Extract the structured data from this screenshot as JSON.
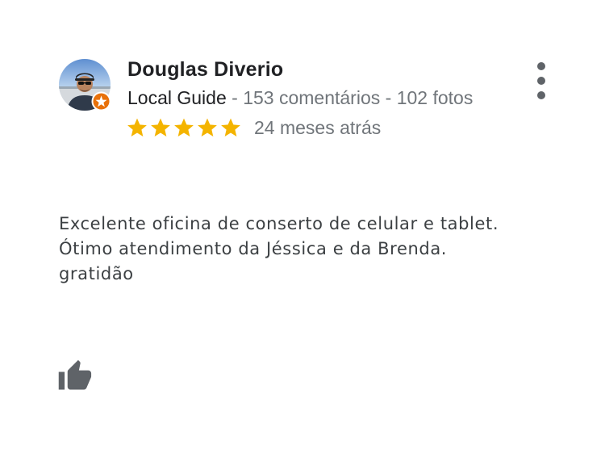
{
  "reviewer": {
    "name": "Douglas Diverio",
    "guide_label": "Local Guide",
    "separator_1": " - ",
    "reviews_count": "153 comentários",
    "separator_2": " - ",
    "photos_count": "102 fotos",
    "avatar_icon": "profile-photo",
    "badge_icon": "local-guide-star-badge"
  },
  "rating": {
    "stars": 5,
    "max": 5,
    "star_color": "#f4b400",
    "date": "24 meses atrás"
  },
  "review": {
    "lines": [
      "Excelente oficina de conserto de celular e tablet.",
      "Ótimo atendimento da Jéssica e da Brenda.",
      "gratidão"
    ]
  },
  "actions": {
    "more_icon": "more-vertical-icon",
    "like_icon": "thumbs-up-icon"
  },
  "colors": {
    "name": "#202124",
    "meta": "#70757a",
    "body_text": "#3c4043",
    "icon": "#5f6368",
    "badge": "#e8710a"
  }
}
